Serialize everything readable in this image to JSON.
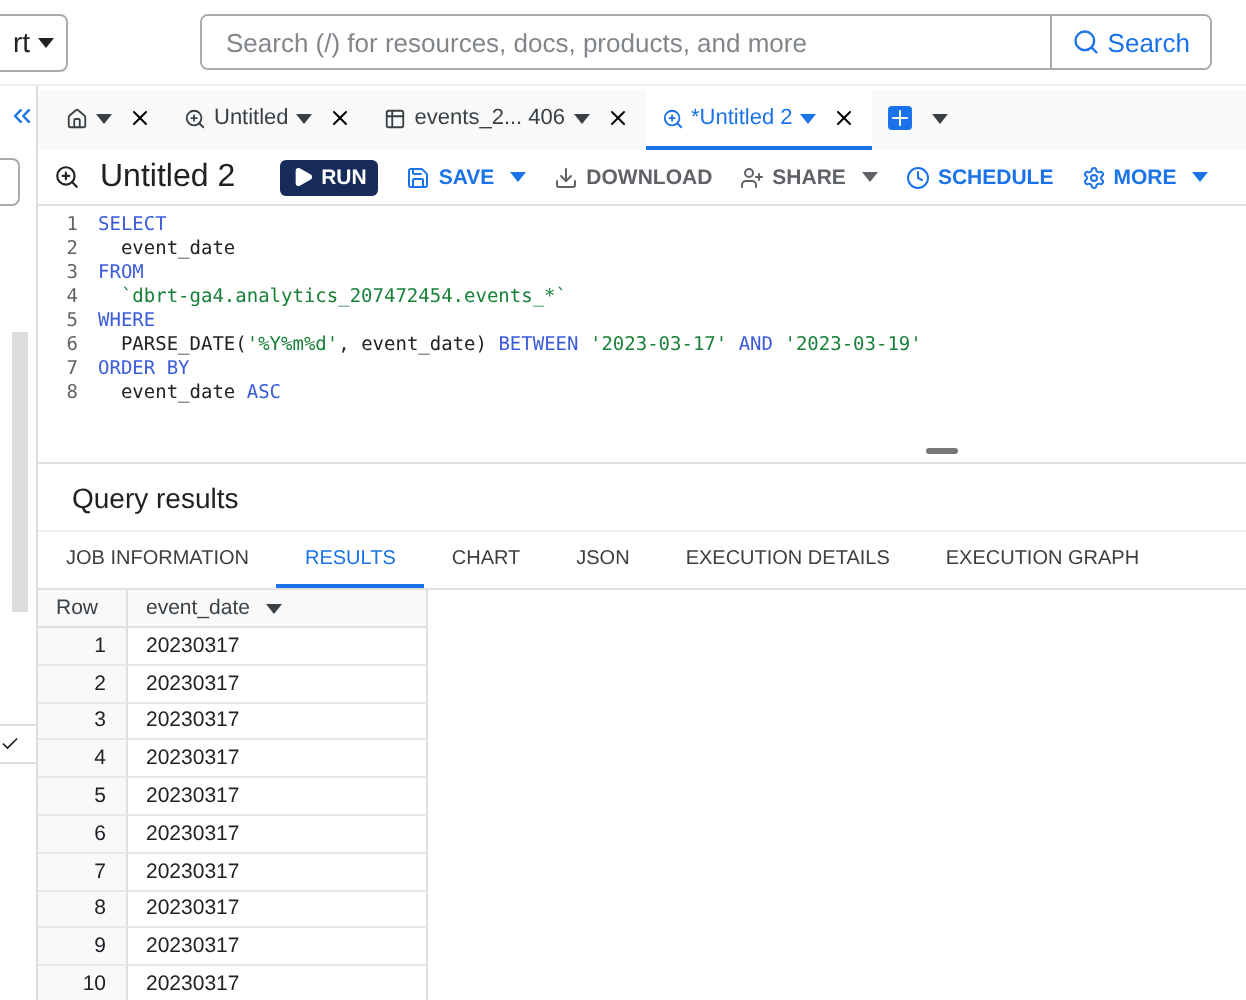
{
  "top_bar": {
    "project_label": "rt",
    "search": {
      "placeholder": "Search (/) for resources, docs, products, and more",
      "button": "Search"
    }
  },
  "editor_tabs": [
    {
      "kind": "home",
      "selected": false
    },
    {
      "kind": "query",
      "label": "Untitled",
      "selected": false
    },
    {
      "kind": "table",
      "label": "events_2... 406",
      "selected": false
    },
    {
      "kind": "query",
      "label": "*Untitled 2",
      "selected": true
    }
  ],
  "toolbar": {
    "title": "Untitled 2",
    "buttons": [
      {
        "kind": "run",
        "label": "RUN",
        "disabled": false
      },
      {
        "kind": "save",
        "label": "SAVE",
        "disabled": false,
        "menu": true
      },
      {
        "kind": "download",
        "label": "DOWNLOAD",
        "disabled": true,
        "menu": false
      },
      {
        "kind": "share",
        "label": "SHARE",
        "disabled": true,
        "menu": true
      },
      {
        "kind": "schedule",
        "label": "SCHEDULE",
        "disabled": false,
        "menu": false
      },
      {
        "kind": "more",
        "label": "MORE",
        "disabled": false,
        "menu": true
      }
    ]
  },
  "code_lines": [
    {
      "number": "1",
      "tokens": [
        {
          "kind": "keyword",
          "text": "SELECT"
        }
      ]
    },
    {
      "number": "2",
      "tokens": [
        {
          "kind": "plain",
          "text": "  event_date"
        }
      ]
    },
    {
      "number": "3",
      "tokens": [
        {
          "kind": "keyword",
          "text": "FROM"
        }
      ]
    },
    {
      "number": "4",
      "tokens": [
        {
          "kind": "string",
          "text": "  `dbrt-ga4.analytics_207472454.events_*`"
        }
      ]
    },
    {
      "number": "5",
      "tokens": [
        {
          "kind": "keyword",
          "text": "WHERE"
        }
      ]
    },
    {
      "number": "6",
      "tokens": [
        {
          "kind": "plain",
          "text": "  PARSE_DATE("
        },
        {
          "kind": "string",
          "text": "'%Y%m%d'"
        },
        {
          "kind": "plain",
          "text": ", event_date) "
        },
        {
          "kind": "keyword",
          "text": "BETWEEN "
        },
        {
          "kind": "string",
          "text": "'2023-03-17'"
        },
        {
          "kind": "keyword",
          "text": " AND "
        },
        {
          "kind": "string",
          "text": "'2023-03-19'"
        }
      ]
    },
    {
      "number": "7",
      "tokens": [
        {
          "kind": "keyword",
          "text": "ORDER BY"
        }
      ]
    },
    {
      "number": "8",
      "tokens": [
        {
          "kind": "plain",
          "text": "  event_date "
        },
        {
          "kind": "keyword",
          "text": "ASC"
        }
      ]
    }
  ],
  "results": {
    "title": "Query results",
    "tabs": [
      {
        "label": "JOB INFORMATION",
        "selected": false
      },
      {
        "label": "RESULTS",
        "selected": true
      },
      {
        "label": "CHART",
        "selected": false
      },
      {
        "label": "JSON",
        "selected": false
      },
      {
        "label": "EXECUTION DETAILS",
        "selected": false
      },
      {
        "label": "EXECUTION GRAPH",
        "selected": false
      }
    ],
    "table": {
      "columns": [
        "Row",
        "event_date"
      ],
      "rows": [
        [
          "1",
          "20230317"
        ],
        [
          "2",
          "20230317"
        ],
        [
          "3",
          "20230317"
        ],
        [
          "4",
          "20230317"
        ],
        [
          "5",
          "20230317"
        ],
        [
          "6",
          "20230317"
        ],
        [
          "7",
          "20230317"
        ],
        [
          "8",
          "20230317"
        ],
        [
          "9",
          "20230317"
        ],
        [
          "10",
          "20230317"
        ]
      ]
    }
  }
}
